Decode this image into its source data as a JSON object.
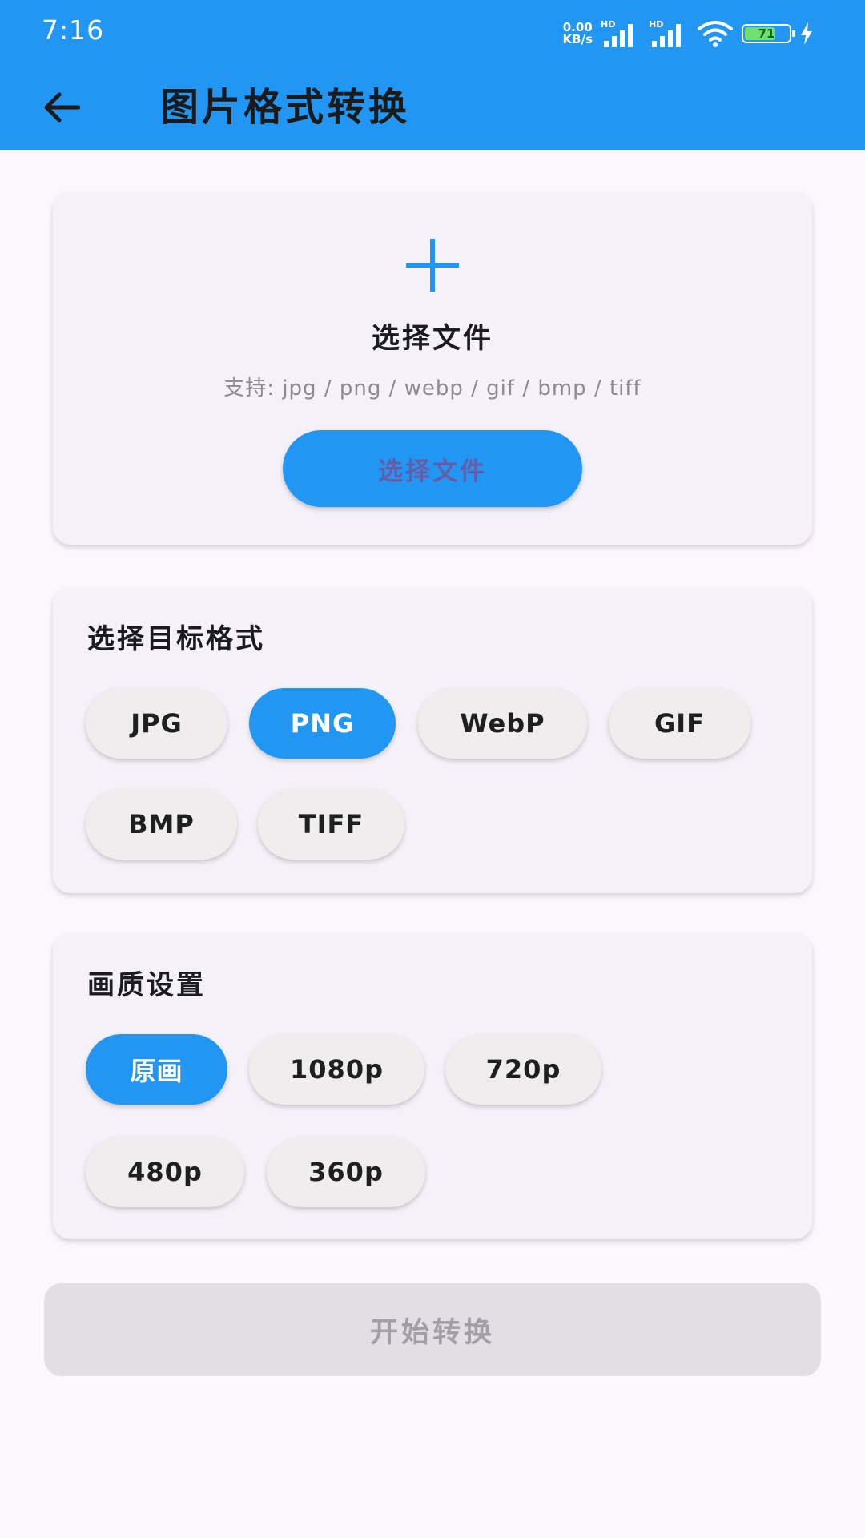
{
  "status_bar": {
    "time": "7:16",
    "net_speed_value": "0.00",
    "net_speed_unit": "KB/s",
    "hd_label_1": "HD",
    "hd_label_2": "HD",
    "battery_level": "71",
    "battery_fraction": 0.71
  },
  "app_bar": {
    "title": "图片格式转换",
    "back_icon": "arrow-left-icon"
  },
  "file_picker": {
    "add_icon": "plus-icon",
    "title": "选择文件",
    "hint": "支持: jpg / png / webp / gif / bmp / tiff",
    "button_label": "选择文件"
  },
  "target_format": {
    "title": "选择目标格式",
    "options": [
      {
        "label": "JPG",
        "selected": false
      },
      {
        "label": "PNG",
        "selected": true
      },
      {
        "label": "WebP",
        "selected": false
      },
      {
        "label": "GIF",
        "selected": false
      },
      {
        "label": "BMP",
        "selected": false
      },
      {
        "label": "TIFF",
        "selected": false
      }
    ]
  },
  "quality": {
    "title": "画质设置",
    "options": [
      {
        "label": "原画",
        "selected": true
      },
      {
        "label": "1080p",
        "selected": false
      },
      {
        "label": "720p",
        "selected": false
      },
      {
        "label": "480p",
        "selected": false
      },
      {
        "label": "360p",
        "selected": false
      }
    ]
  },
  "actions": {
    "start_label": "开始转换"
  },
  "colors": {
    "primary": "#2196f3",
    "card_background": "#f4f1f8",
    "page_background": "#fcf7fc",
    "chip_background": "#efeded",
    "disabled_button": "#e3dee4",
    "disabled_text": "#a29ea5",
    "battery_fill": "#6de06d"
  }
}
